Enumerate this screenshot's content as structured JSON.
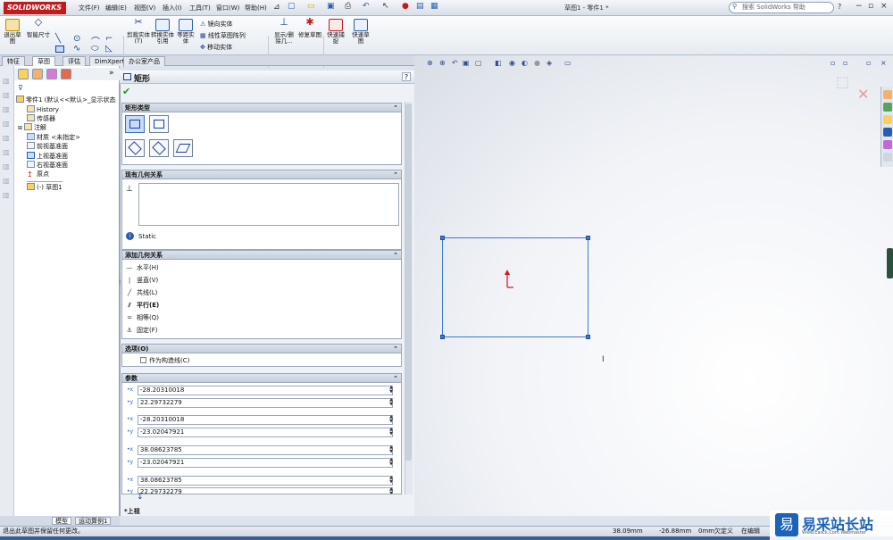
{
  "titlebar": {
    "app_logo": "SOLIDWORKS",
    "menus": [
      "文件(F)",
      "编辑(E)",
      "视图(V)",
      "插入(I)",
      "工具(T)",
      "窗口(W)",
      "帮助(H)"
    ],
    "doc_title": "草图1 - 零件1 *",
    "search_placeholder": "搜索 SolidWorks 帮助"
  },
  "ribbon": {
    "exit_sketch": "退出草图",
    "smart_dimension": "智能尺寸",
    "trim": "剪裁实体(T)",
    "convert": "转换实体引用",
    "offset": "等距实体",
    "mirror": "镜向实体",
    "linear_pattern": "线性草图阵列",
    "move": "移动实体",
    "display_delete": "显示/删除几...",
    "repair": "修复草图",
    "quick_snap": "快速捕捉",
    "rapid_sketch": "快速草图"
  },
  "tabs": [
    "特征",
    "草图",
    "评估",
    "DimXpert",
    "办公室产品"
  ],
  "active_tab": 1,
  "feature_tree": {
    "root": "零件1 (默认<<默认>_显示状态",
    "items": [
      "History",
      "传感器",
      "注解",
      "材质 <未指定>",
      "前视基准面",
      "上视基准面",
      "右视基准面",
      "原点"
    ],
    "sketch": "(-) 草图1"
  },
  "bottom_tabs": [
    "模型",
    "运动算例1"
  ],
  "property_manager": {
    "title": "矩形",
    "rect_type_header": "矩形类型",
    "existing_rel_header": "现有几何关系",
    "status_text": "Static",
    "add_rel_header": "添加几何关系",
    "relations": [
      "水平(H)",
      "竖直(V)",
      "共线(L)",
      "平行(E)",
      "相等(Q)",
      "固定(F)"
    ],
    "options_header": "选项(O)",
    "construction_label": "作为构造线(C)",
    "params_header": "参数",
    "params": [
      "-28.20310018",
      "22.29732279",
      "-28.20310018",
      "-23.02047921",
      "38.08623785",
      "-23.02047921",
      "38.08623785",
      "22.29732279"
    ]
  },
  "view_label": "*上视",
  "statusbar": {
    "message": "退出此草图并保留任何更改。",
    "x": "38.09mm",
    "y": "-26.88mm",
    "z": "0mm",
    "state": "欠定义",
    "editing": "在编辑"
  },
  "watermark": {
    "logo": "易",
    "text": "易采站长站",
    "url": "Www.Easck.Com Webmaster"
  }
}
